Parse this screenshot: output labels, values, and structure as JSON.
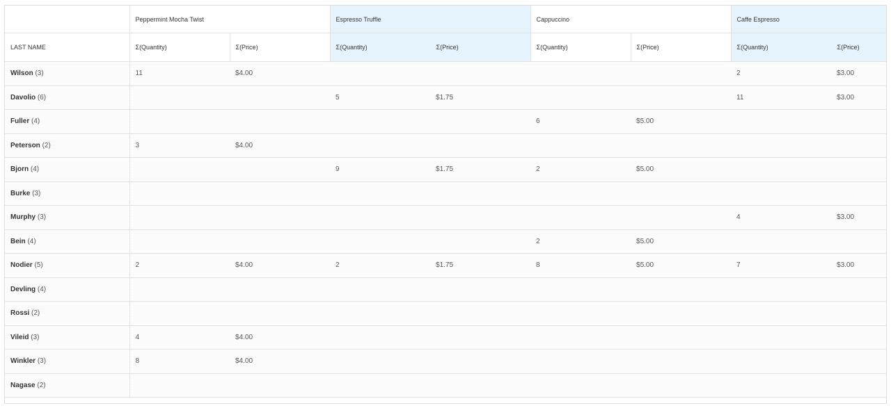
{
  "header": {
    "row_field_label": "LAST NAME",
    "groups": [
      {
        "label": "Peppermint Mocha Twist",
        "highlight": false
      },
      {
        "label": "Espresso Truffle",
        "highlight": true
      },
      {
        "label": "Cappuccino",
        "highlight": false
      },
      {
        "label": "Caffe Espresso",
        "highlight": true
      }
    ],
    "measure_quantity": "Σ(Quantity)",
    "measure_price": "Σ(Price)"
  },
  "rows": [
    {
      "name": "Wilson",
      "count": "(3)",
      "cells": [
        "11",
        "$4.00",
        "",
        "",
        "",
        "",
        "2",
        "$3.00"
      ]
    },
    {
      "name": "Davolio",
      "count": "(6)",
      "cells": [
        "",
        "",
        "5",
        "$1.75",
        "",
        "",
        "11",
        "$3.00"
      ]
    },
    {
      "name": "Fuller",
      "count": "(4)",
      "cells": [
        "",
        "",
        "",
        "",
        "6",
        "$5.00",
        "",
        ""
      ]
    },
    {
      "name": "Peterson",
      "count": "(2)",
      "cells": [
        "3",
        "$4.00",
        "",
        "",
        "",
        "",
        "",
        ""
      ]
    },
    {
      "name": "Bjorn",
      "count": "(4)",
      "cells": [
        "",
        "",
        "9",
        "$1.75",
        "2",
        "$5.00",
        "",
        ""
      ]
    },
    {
      "name": "Burke",
      "count": "(3)",
      "cells": [
        "",
        "",
        "",
        "",
        "",
        "",
        "",
        ""
      ]
    },
    {
      "name": "Murphy",
      "count": "(3)",
      "cells": [
        "",
        "",
        "",
        "",
        "",
        "",
        "4",
        "$3.00"
      ]
    },
    {
      "name": "Bein",
      "count": "(4)",
      "cells": [
        "",
        "",
        "",
        "",
        "2",
        "$5.00",
        "",
        ""
      ]
    },
    {
      "name": "Nodier",
      "count": "(5)",
      "cells": [
        "2",
        "$4.00",
        "2",
        "$1.75",
        "8",
        "$5.00",
        "7",
        "$3.00"
      ]
    },
    {
      "name": "Devling",
      "count": "(4)",
      "cells": [
        "",
        "",
        "",
        "",
        "",
        "",
        "",
        ""
      ]
    },
    {
      "name": "Rossi",
      "count": "(2)",
      "cells": [
        "",
        "",
        "",
        "",
        "",
        "",
        "",
        ""
      ]
    },
    {
      "name": "Vileid",
      "count": "(3)",
      "cells": [
        "4",
        "$4.00",
        "",
        "",
        "",
        "",
        "",
        ""
      ]
    },
    {
      "name": "Winkler",
      "count": "(3)",
      "cells": [
        "8",
        "$4.00",
        "",
        "",
        "",
        "",
        "",
        ""
      ]
    },
    {
      "name": "Nagase",
      "count": "(2)",
      "cells": [
        "",
        "",
        "",
        "",
        "",
        "",
        "",
        ""
      ]
    }
  ]
}
